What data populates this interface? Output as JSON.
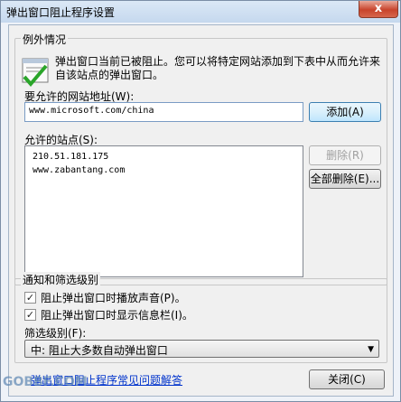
{
  "window": {
    "title": "弹出窗口阻止程序设置",
    "close_glyph": "x"
  },
  "exceptions": {
    "legend": "例外情况",
    "description": "弹出窗口当前已被阻止。您可以将特定网站添加到下表中从而允许来自该站点的弹出窗口。",
    "address_label": "要允许的网站地址(W):",
    "address_value": "www.microsoft.com/china",
    "add_button": "添加(A)",
    "allowed_label": "允许的站点(S):",
    "allowed_sites": [
      "210.51.181.175",
      "www.zabantang.com"
    ],
    "remove_button": "删除(R)",
    "remove_all_button": "全部删除(E)..."
  },
  "notifications": {
    "legend": "通知和筛选级别",
    "play_sound": {
      "label": "阻止弹出窗口时播放声音(P)。",
      "checked": true
    },
    "show_infobar": {
      "label": "阻止弹出窗口时显示信息栏(I)。",
      "checked": true
    },
    "filter_label": "筛选级别(F):",
    "filter_value": "中: 阻止大多数自动弹出窗口"
  },
  "footer": {
    "help_link": "弹出窗口阻止程序常见问题解答",
    "close_button": "关闭(C)",
    "watermark": "GOBBF.COM"
  },
  "colors": {
    "link": "#0033cc",
    "title_bg": "#dbe8f6",
    "close_red": "#c8442c"
  }
}
